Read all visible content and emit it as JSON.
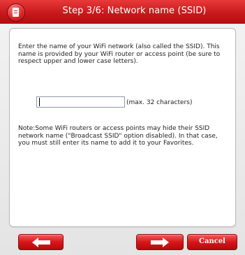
{
  "window": {
    "title": "Step 3/6: Network name (SSID)"
  },
  "content": {
    "intro": "Enter the name of your WiFi network (also called the SSID). This name is provided by your WiFi router or access point (be sure to respect upper and lower case letters).",
    "ssid_input": {
      "value": "",
      "placeholder": ""
    },
    "hint": "(max. 32 characters)",
    "note": "Note:Some WiFi routers or access points may hide their SSID network name (\"Broadcast SSID\" option disabled). In that case, you must still enter its name to add it to your Favorites."
  },
  "footer": {
    "back_icon": "arrow-left-icon",
    "next_icon": "arrow-right-icon",
    "cancel_label": "Cancel"
  },
  "colors": {
    "accent": "#d21a1d",
    "title_text": "#ffffff"
  }
}
